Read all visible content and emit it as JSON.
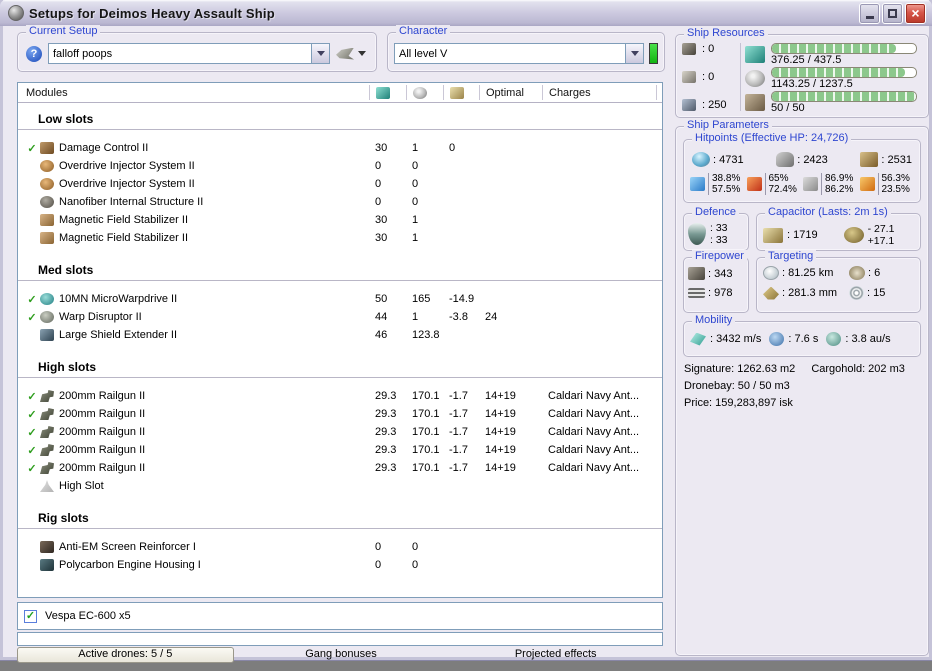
{
  "window": {
    "title": "Setups for Deimos Heavy Assault Ship"
  },
  "current_setup": {
    "label": "Current Setup",
    "help_glyph": "?",
    "value": "falloff poops"
  },
  "character": {
    "label": "Character",
    "value": "All level V"
  },
  "ship_resources": {
    "label": "Ship Resources",
    "hardpoints": [
      {
        "icon": "turret-hardpoint-icon",
        "value": ": 0"
      },
      {
        "icon": "launcher-hardpoint-icon",
        "value": ": 0"
      },
      {
        "icon": "calibration-icon",
        "value": ": 250"
      }
    ],
    "bars": [
      {
        "icon": "cpu-icon",
        "text": "376.25 / 437.5",
        "pct": 86
      },
      {
        "icon": "powergrid-icon",
        "text": "1143.25 / 1237.5",
        "pct": 92.4
      },
      {
        "icon": "dronebay-icon",
        "text": "50 / 50",
        "pct": 100
      }
    ]
  },
  "modules": {
    "header_label": "Modules",
    "column_icons": [
      "cpu-icon",
      "powergrid-icon",
      "capacitor-icon"
    ],
    "optimal_label": "Optimal",
    "charges_label": "Charges",
    "sections": [
      {
        "title": "Low slots",
        "rows": [
          {
            "fitted": true,
            "icon": "damage-control-icon",
            "name": "Damage Control II",
            "values": [
              "30",
              "1",
              "0",
              ""
            ],
            "charge": ""
          },
          {
            "fitted": false,
            "icon": "overdrive-icon",
            "name": "Overdrive Injector System II",
            "values": [
              "0",
              "0",
              "",
              ""
            ],
            "charge": ""
          },
          {
            "fitted": false,
            "icon": "overdrive-icon",
            "name": "Overdrive Injector System II",
            "values": [
              "0",
              "0",
              "",
              ""
            ],
            "charge": ""
          },
          {
            "fitted": false,
            "icon": "nanofiber-icon",
            "name": "Nanofiber Internal Structure II",
            "values": [
              "0",
              "0",
              "",
              ""
            ],
            "charge": ""
          },
          {
            "fitted": false,
            "icon": "magstab-icon",
            "name": "Magnetic Field Stabilizer II",
            "values": [
              "30",
              "1",
              "",
              ""
            ],
            "charge": ""
          },
          {
            "fitted": false,
            "icon": "magstab-icon",
            "name": "Magnetic Field Stabilizer II",
            "values": [
              "30",
              "1",
              "",
              ""
            ],
            "charge": ""
          }
        ]
      },
      {
        "title": "Med slots",
        "rows": [
          {
            "fitted": true,
            "icon": "mwd-icon",
            "name": "10MN MicroWarpdrive II",
            "values": [
              "50",
              "165",
              "-14.9",
              ""
            ],
            "charge": ""
          },
          {
            "fitted": true,
            "icon": "disruptor-icon",
            "name": "Warp Disruptor II",
            "values": [
              "44",
              "1",
              "-3.8",
              "24"
            ],
            "charge": ""
          },
          {
            "fitted": false,
            "icon": "shield-extender-icon",
            "name": "Large Shield Extender II",
            "values": [
              "46",
              "123.8",
              "",
              ""
            ],
            "charge": ""
          }
        ]
      },
      {
        "title": "High slots",
        "rows": [
          {
            "fitted": true,
            "icon": "railgun-icon",
            "name": "200mm Railgun II",
            "values": [
              "29.3",
              "170.1",
              "-1.7",
              "14+19"
            ],
            "charge": "Caldari Navy Ant..."
          },
          {
            "fitted": true,
            "icon": "railgun-icon",
            "name": "200mm Railgun II",
            "values": [
              "29.3",
              "170.1",
              "-1.7",
              "14+19"
            ],
            "charge": "Caldari Navy Ant..."
          },
          {
            "fitted": true,
            "icon": "railgun-icon",
            "name": "200mm Railgun II",
            "values": [
              "29.3",
              "170.1",
              "-1.7",
              "14+19"
            ],
            "charge": "Caldari Navy Ant..."
          },
          {
            "fitted": true,
            "icon": "railgun-icon",
            "name": "200mm Railgun II",
            "values": [
              "29.3",
              "170.1",
              "-1.7",
              "14+19"
            ],
            "charge": "Caldari Navy Ant..."
          },
          {
            "fitted": true,
            "icon": "railgun-icon",
            "name": "200mm Railgun II",
            "values": [
              "29.3",
              "170.1",
              "-1.7",
              "14+19"
            ],
            "charge": "Caldari Navy Ant..."
          },
          {
            "fitted": false,
            "icon": "empty-slot-icon",
            "name": "High Slot",
            "values": [
              "",
              "",
              "",
              ""
            ],
            "charge": ""
          }
        ]
      },
      {
        "title": "Rig slots",
        "rows": [
          {
            "fitted": false,
            "icon": "anti-em-rig-icon",
            "name": "Anti-EM Screen Reinforcer I",
            "values": [
              "0",
              "0",
              "",
              ""
            ],
            "charge": ""
          },
          {
            "fitted": false,
            "icon": "polycarbon-rig-icon",
            "name": "Polycarbon Engine Housing I",
            "values": [
              "0",
              "0",
              "",
              ""
            ],
            "charge": ""
          }
        ]
      }
    ]
  },
  "drones": {
    "checked": true,
    "check_glyph": "✓",
    "name": "Vespa EC-600 x5"
  },
  "tabs": [
    {
      "label": "Active drones: 5 / 5",
      "active": true
    },
    {
      "label": "Gang bonuses",
      "active": false
    },
    {
      "label": "Projected effects",
      "active": false
    }
  ],
  "ship_parameters": {
    "label": "Ship Parameters",
    "hitpoints": {
      "label": "Hitpoints (Effective HP: 24,726)",
      "shield": ": 4731",
      "armor": ": 2423",
      "structure": ": 2531",
      "resists": [
        {
          "icon": "em-resist-icon",
          "top": "38.8%",
          "bottom": "57.5%"
        },
        {
          "icon": "thermal-resist-icon",
          "top": "65%",
          "bottom": "72.4%"
        },
        {
          "icon": "kinetic-resist-icon",
          "top": "86.9%",
          "bottom": "86.2%"
        },
        {
          "icon": "explosive-resist-icon",
          "top": "56.3%",
          "bottom": "23.5%"
        }
      ]
    },
    "defence": {
      "label": "Defence",
      "top": ": 33",
      "bottom": ": 33"
    },
    "capacitor": {
      "label": "Capacitor (Lasts: 2m 1s)",
      "amount": ": 1719",
      "delta_top": "- 27.1",
      "delta_bottom": "+17.1"
    },
    "firepower": {
      "label": "Firepower",
      "dps": ": 343",
      "volley": ": 978"
    },
    "targeting": {
      "label": "Targeting",
      "range": ": 81.25 km",
      "max_targets": ": 6",
      "scan_res": ": 281.3 mm",
      "sensor_strength": ": 15"
    },
    "mobility": {
      "label": "Mobility",
      "speed": ": 3432 m/s",
      "align": ": 7.6 s",
      "warp": ": 3.8 au/s"
    },
    "stats": {
      "signature": "Signature: 1262.63 m2",
      "cargohold": "Cargohold: 202 m3",
      "dronebay": "Dronebay: 50 / 50 m3",
      "price": "Price: 159,283,897 isk"
    }
  }
}
